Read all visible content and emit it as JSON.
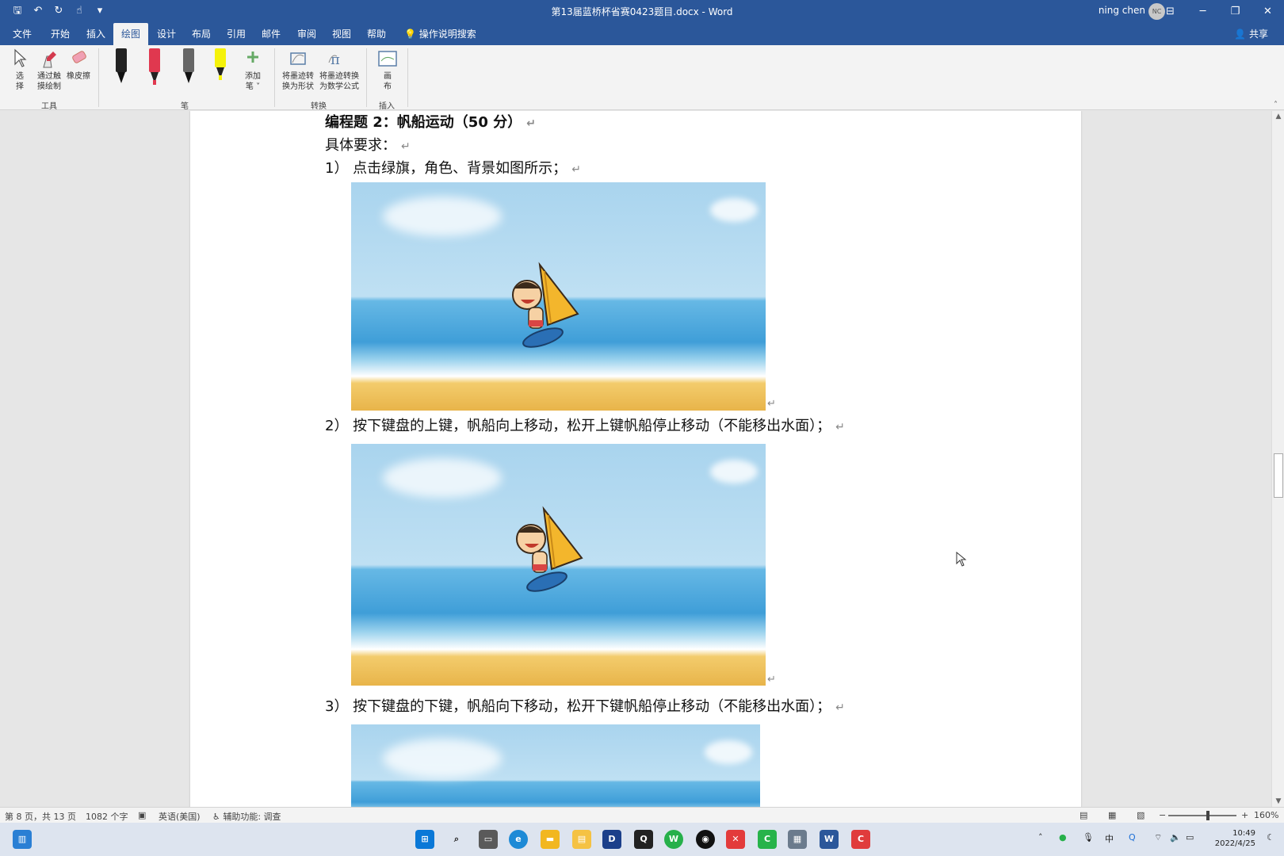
{
  "window": {
    "title": "第13届蓝桥杯省赛0423题目.docx  -  Word",
    "user": "ning chen",
    "avatar_initials": "NC",
    "controls": {
      "ribbon_display": "⊟",
      "minimize": "─",
      "restore": "❐",
      "close": "✕"
    }
  },
  "qat": {
    "save": "🖫",
    "undo": "↶",
    "redo": "↻",
    "touch": "☝",
    "customize": "▾"
  },
  "tabs": [
    "文件",
    "开始",
    "插入",
    "绘图",
    "设计",
    "布局",
    "引用",
    "邮件",
    "审阅",
    "视图",
    "帮助"
  ],
  "active_tab": "绘图",
  "tell_me": "操作说明搜索",
  "share": "共享",
  "ribbon": {
    "tools": {
      "select": "选\n择",
      "touch_draw": "通过触\n摸绘制",
      "eraser": "橡皮擦",
      "group": "工具"
    },
    "pens": {
      "add_pen": "添加\n笔 ˅",
      "group": "笔"
    },
    "convert": {
      "ink_to_shape": "将墨迹转\n换为形状",
      "ink_to_math": "将墨迹转换\n为数学公式",
      "group": "转换"
    },
    "insert": {
      "canvas": "画\n布",
      "group": "插入"
    }
  },
  "document": {
    "heading": "编程题 2：帆船运动（50 分）",
    "requirements_label": "具体要求：",
    "items": [
      "1）  点击绿旗，角色、背景如图所示；",
      "2）  按下键盘的上键，帆船向上移动，松开上键帆船停止移动（不能移出水面）；",
      "3）  按下键盘的下键，帆船向下移动，松开下键帆船停止移动（不能移出水面）；"
    ],
    "paragraph_mark": "↵"
  },
  "status": {
    "page": "第 8 页，共 13 页",
    "words": "1082 个字",
    "language": "英语(美国)",
    "accessibility": "辅助功能: 调查",
    "zoom": "160%"
  },
  "taskbar": {
    "time": "10:49",
    "date": "2022/4/25",
    "ime": "中"
  }
}
